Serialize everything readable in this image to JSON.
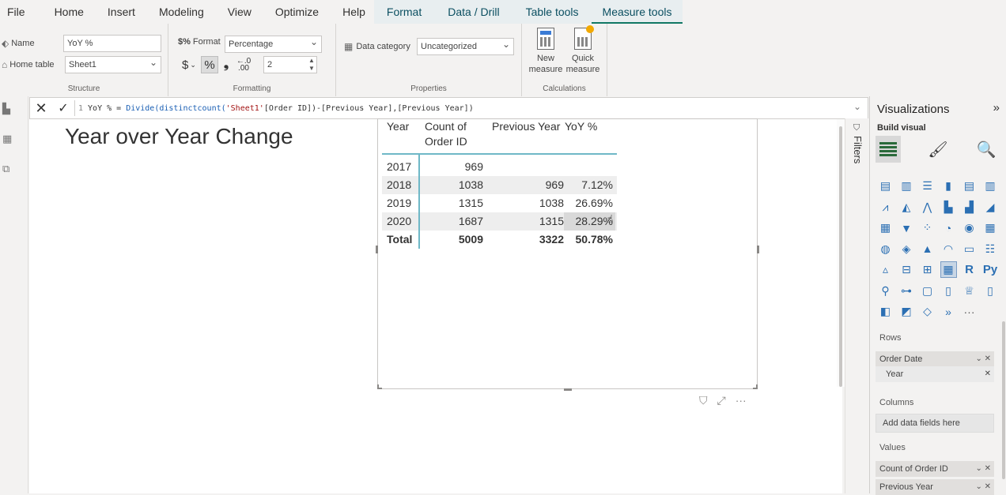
{
  "menu": {
    "items": [
      "File",
      "Home",
      "Insert",
      "Modeling",
      "View",
      "Optimize",
      "Help"
    ],
    "context_tabs": [
      "Format",
      "Data / Drill",
      "Table tools",
      "Measure tools"
    ],
    "active_tab": "Measure tools"
  },
  "ribbon": {
    "structure": {
      "name_label": "Name",
      "name_value": "YoY %",
      "home_table_label": "Home table",
      "home_table_value": "Sheet1",
      "group_label": "Structure"
    },
    "formatting": {
      "format_label": "Format",
      "format_value": "Percentage",
      "currency_symbol": "$",
      "percent_symbol": "%",
      "comma_symbol": "❟",
      "decimals_value": "2",
      "group_label": "Formatting"
    },
    "properties": {
      "data_category_label": "Data category",
      "data_category_value": "Uncategorized",
      "group_label": "Properties"
    },
    "calculations": {
      "new_measure_line1": "New",
      "new_measure_line2": "measure",
      "quick_measure_line1": "Quick",
      "quick_measure_line2": "measure",
      "group_label": "Calculations"
    }
  },
  "formula": {
    "line_number": "1",
    "prefix": "YoY % = ",
    "fn": "Divide(distinctcount(",
    "str": "'Sheet1'",
    "rest": "[Order ID])-[Previous Year],[Previous Year])"
  },
  "canvas": {
    "title": "Year over Year Change"
  },
  "matrix": {
    "headers": [
      "Year",
      "Count of Order ID",
      "Previous Year",
      "YoY %"
    ],
    "header_c2_line1": "Count of",
    "header_c2_line2": "Order ID",
    "rows": [
      {
        "year": "2017",
        "count": "969",
        "prev": "",
        "yoy": ""
      },
      {
        "year": "2018",
        "count": "1038",
        "prev": "969",
        "yoy": "7.12%"
      },
      {
        "year": "2019",
        "count": "1315",
        "prev": "1038",
        "yoy": "26.69%"
      },
      {
        "year": "2020",
        "count": "1687",
        "prev": "1315",
        "yoy": "28.29%"
      }
    ],
    "total": {
      "label": "Total",
      "count": "5009",
      "prev": "3322",
      "yoy": "50.78%"
    }
  },
  "filters": {
    "label": "Filters"
  },
  "visualizations": {
    "title": "Visualizations",
    "build_label": "Build visual",
    "rows_label": "Rows",
    "rows_field": "Order Date",
    "rows_subfield": "Year",
    "columns_label": "Columns",
    "columns_placeholder": "Add data fields here",
    "values_label": "Values",
    "values_fields": [
      "Count of Order ID",
      "Previous Year"
    ],
    "r_label": "R",
    "py_label": "Py",
    "more_label": "···"
  }
}
